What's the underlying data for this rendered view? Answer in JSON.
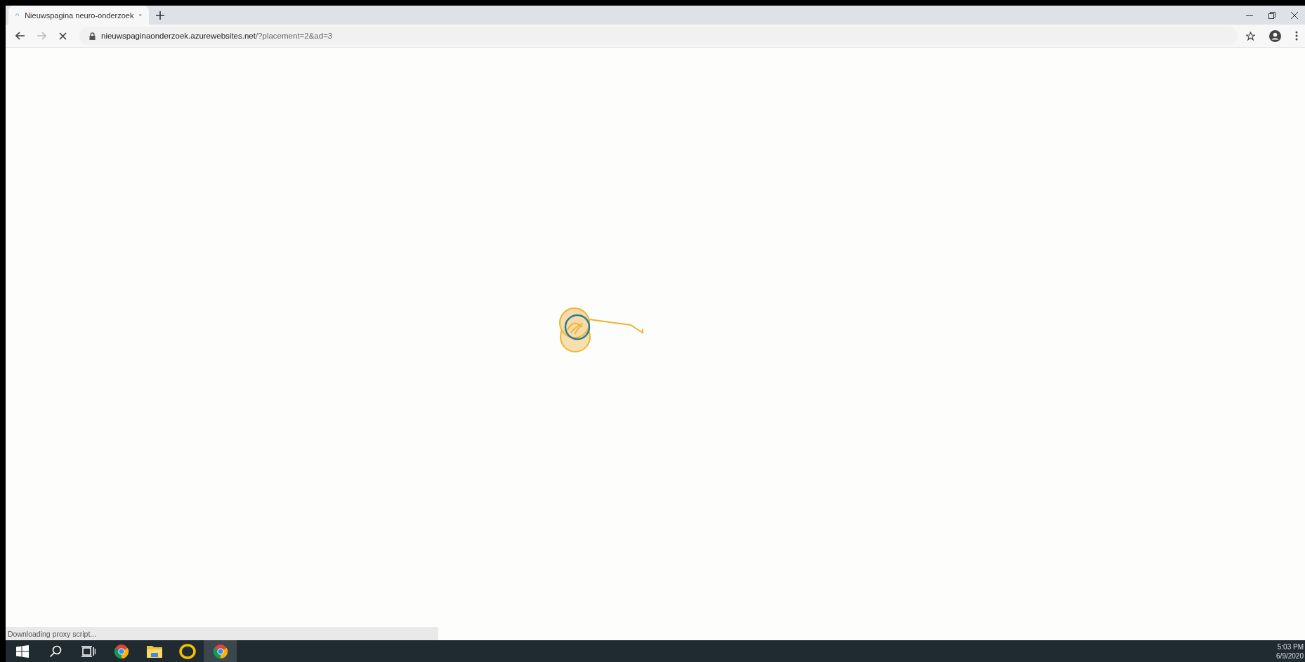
{
  "browser": {
    "tabs": [
      {
        "title": "Nieuwspagina neuro-onderzoek",
        "selected": true,
        "loading": true
      }
    ],
    "address": {
      "host": "nieuwspaginaonderzoek.azurewebsites.net",
      "path": "/?placement=2&ad=3"
    },
    "loading": true
  },
  "status_bubble": {
    "text": "Downloading proxy script..."
  },
  "taskbar": {
    "items": [
      {
        "kind": "start",
        "selected": false
      },
      {
        "kind": "search",
        "selected": false
      },
      {
        "kind": "taskview",
        "selected": false
      },
      {
        "kind": "chrome",
        "selected": false
      },
      {
        "kind": "folder",
        "selected": false
      },
      {
        "kind": "ring",
        "selected": false
      },
      {
        "kind": "chrome",
        "selected": true
      }
    ],
    "time": "5:03 PM",
    "date": "6/9/2020"
  }
}
